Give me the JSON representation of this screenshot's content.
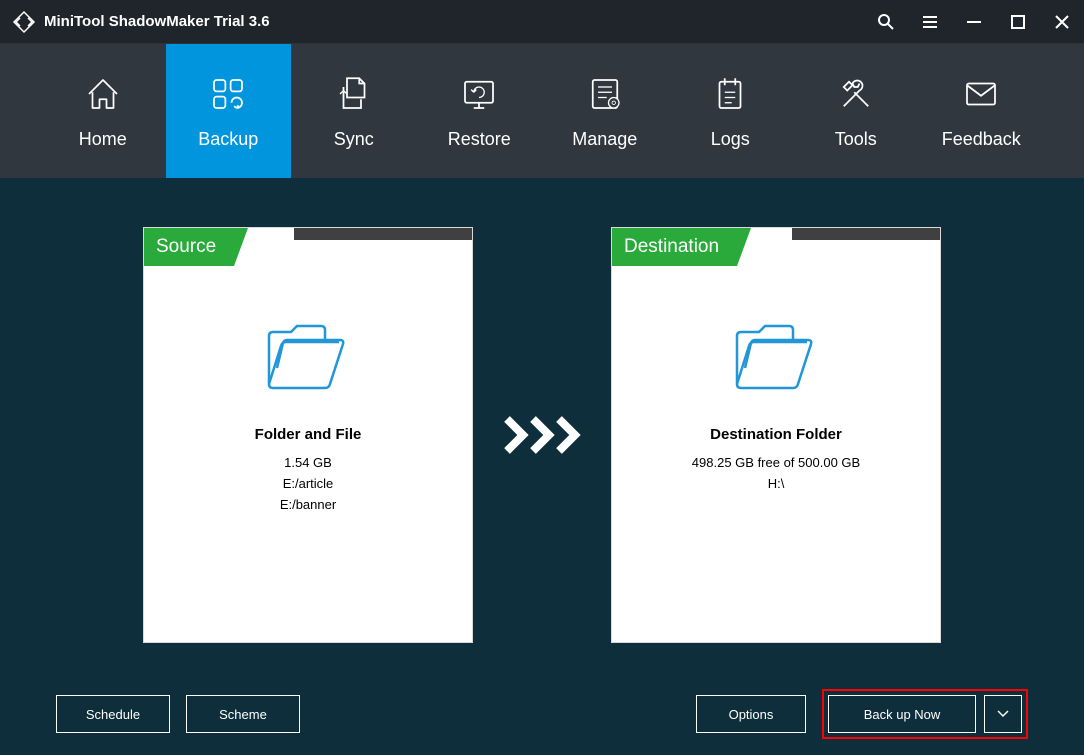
{
  "app": {
    "title": "MiniTool ShadowMaker Trial 3.6"
  },
  "nav": {
    "tabs": [
      {
        "label": "Home"
      },
      {
        "label": "Backup"
      },
      {
        "label": "Sync"
      },
      {
        "label": "Restore"
      },
      {
        "label": "Manage"
      },
      {
        "label": "Logs"
      },
      {
        "label": "Tools"
      },
      {
        "label": "Feedback"
      }
    ],
    "activeIndex": 1
  },
  "source": {
    "header": "Source",
    "title": "Folder and File",
    "size": "1.54 GB",
    "paths": [
      "E:/article",
      "E:/banner"
    ]
  },
  "destination": {
    "header": "Destination",
    "title": "Destination Folder",
    "freeSpace": "498.25 GB free of 500.00 GB",
    "path": "H:\\"
  },
  "footer": {
    "schedule": "Schedule",
    "scheme": "Scheme",
    "options": "Options",
    "backupNow": "Back up Now"
  }
}
